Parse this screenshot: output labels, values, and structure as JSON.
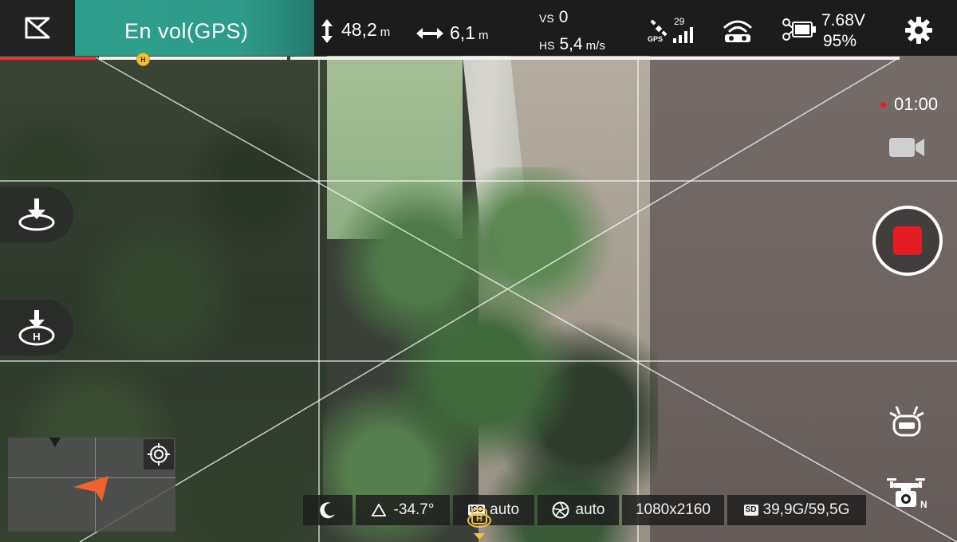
{
  "status": {
    "flight_mode": "En vol(GPS)"
  },
  "telemetry": {
    "altitude": {
      "value": "48,2",
      "unit": "m"
    },
    "distance": {
      "value": "6,1",
      "unit": "m"
    },
    "vs": {
      "label": "VS",
      "value": "0"
    },
    "hs": {
      "label": "HS",
      "value": "5,4",
      "unit": "m/s"
    }
  },
  "signal": {
    "satellites": "29",
    "gps_label": "GPS"
  },
  "battery": {
    "voltage": "7.68V",
    "percent": "95%"
  },
  "progress": {
    "home_marker": "H"
  },
  "recording": {
    "time": "01:00"
  },
  "bottom": {
    "gimbal_angle": "-34.7°",
    "iso_badge": "ISO",
    "iso_value": "auto",
    "shutter_value": "auto",
    "resolution": "1080x2160",
    "sd_badge": "SD",
    "storage": "39,9G/59,5G"
  },
  "minimap": {
    "compass_letter": "N"
  },
  "colors": {
    "accent_teal": "#2c9f8a",
    "record_red": "#e51c23",
    "home_yellow": "#f1c232",
    "arrow_orange": "#f0612e"
  }
}
